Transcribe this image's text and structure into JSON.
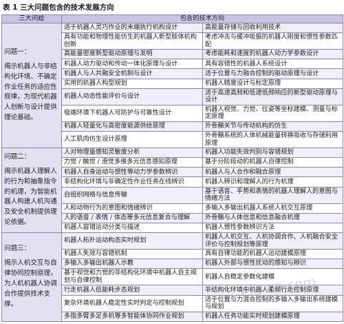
{
  "caption": "表 1   三大问题包含的技术发展方向",
  "headers": {
    "col1": "三大问题",
    "col2": "包含的技术方向"
  },
  "groups": [
    {
      "label": "问题一：",
      "desc": "揭示机器人与非结构化环境、不确定作业任务的适应性规律，为现代机器人创新与设计提供理论基础。",
      "rows": [
        [
          "适于机器人灵巧作业的末端执行机构设计",
          "高能量存储与回收利用技术"
        ],
        [
          "具有功能和物理性能仿生的机器人新型肢体机构创新",
          "考虑冲击与缓冲吸振的机器人刚度和惯性参数匹配"
        ],
        [
          "高能量密度新型驱动原理与发明",
          "考虑能耗和速度的机器人动力学参数设计"
        ],
        [
          "机器人动力驱动和传动一体化原理与设计",
          "具有容错性的机器人系统设计"
        ],
        [
          "机器人与人共融安全机制与设计",
          "适于位置与力融合控制的驱动原理与设计"
        ],
        [
          "实用的机器人构型规划",
          "机器人精度设计与标定原理"
        ],
        [
          "机器人动态性能评价与设计",
          "适于高速高频和低速低频响应的新型驱动原理与设计"
        ],
        [
          "极端环境下机器人可防护与可靠性设计",
          "机器人视觉、力觉、位姿等坐标建模、测量与标定原理"
        ],
        [
          "机器人轻量化与高密度能源供给原理",
          "外骨骼关节与传动机构的仿生"
        ],
        [
          "人工肌肉仿生设计原理",
          "外骨骼系统的人体机械能量转换吸收与存储利用原理"
        ]
      ]
    },
    {
      "label": "问题二：",
      "desc": "揭示机器人理解人的行为和抽象指令的机理，为智能机器人构建人机沟通及安全机制提供理论依据。",
      "rows": [
        [
          "人对物理量感知灵敏度分析",
          "机器人功能失效判别与容错规划"
        ],
        [
          "力觉 / 触觉 / 滑觉多维多元信息感知原理",
          "基于分阶段动的机器人自律控制"
        ],
        [
          "机器人自身运动与惯性等动力学参数辨识",
          "机器人与人合作和融合原理"
        ],
        [
          "非结构化环境与非确定性作业任务在线辨识",
          "机器人辨识和理解人的行为机理"
        ],
        [
          "自组织网络与信息传输",
          "基于语音、手势和表情的机器人理解人的意图与情绪方法"
        ],
        [
          "人和动物行为的意图和情绪辨识",
          "多输入多输出机器人系统人机交互原理"
        ],
        [
          "人的语音 / 表情 / 体态等多元信息复合与理解",
          "外骨骼与人体信息和信息融合机理"
        ],
        [
          "机器人容错运动分类与描述",
          "机器人惯性参数辨识方法"
        ]
      ]
    },
    {
      "label": "问题三：",
      "desc": "揭示人机交互与自律协同控制原理，为人机机器人协调合作提供技术支撑。",
      "rows": [
        [
          "机器人拓扑运动构态实时规划",
          "机器人人机交互、人机协调合作、人机融合安全评价与控制规划等原理"
        ],
        [
          "机器人失效与容错机制",
          "具有自律功能的机器人运动建模原理"
        ],
        [
          "多输入多输出机器人示教",
          "机器人外部与惯性扰动的感知与辨识"
        ],
        [
          "基于视觉和力觉的非结构化环境中机器人自主规划与自律控制",
          "机器人自稳定参数化建模"
        ],
        [
          "行走机器人低能耗步态规划",
          "非结构化环境中机器人柔顺行走控制原理"
        ],
        [
          "复杂环境机器人稳定性实时判定与控制规划",
          "适于位置与力混合控制的多输入多输出系统建模与规划"
        ],
        [
          "多指多臂多足多机等多智能体协同作业规划",
          "机器人任务功能实时规划建模原理"
        ]
      ]
    }
  ],
  "watermark": "ele-cn.com"
}
